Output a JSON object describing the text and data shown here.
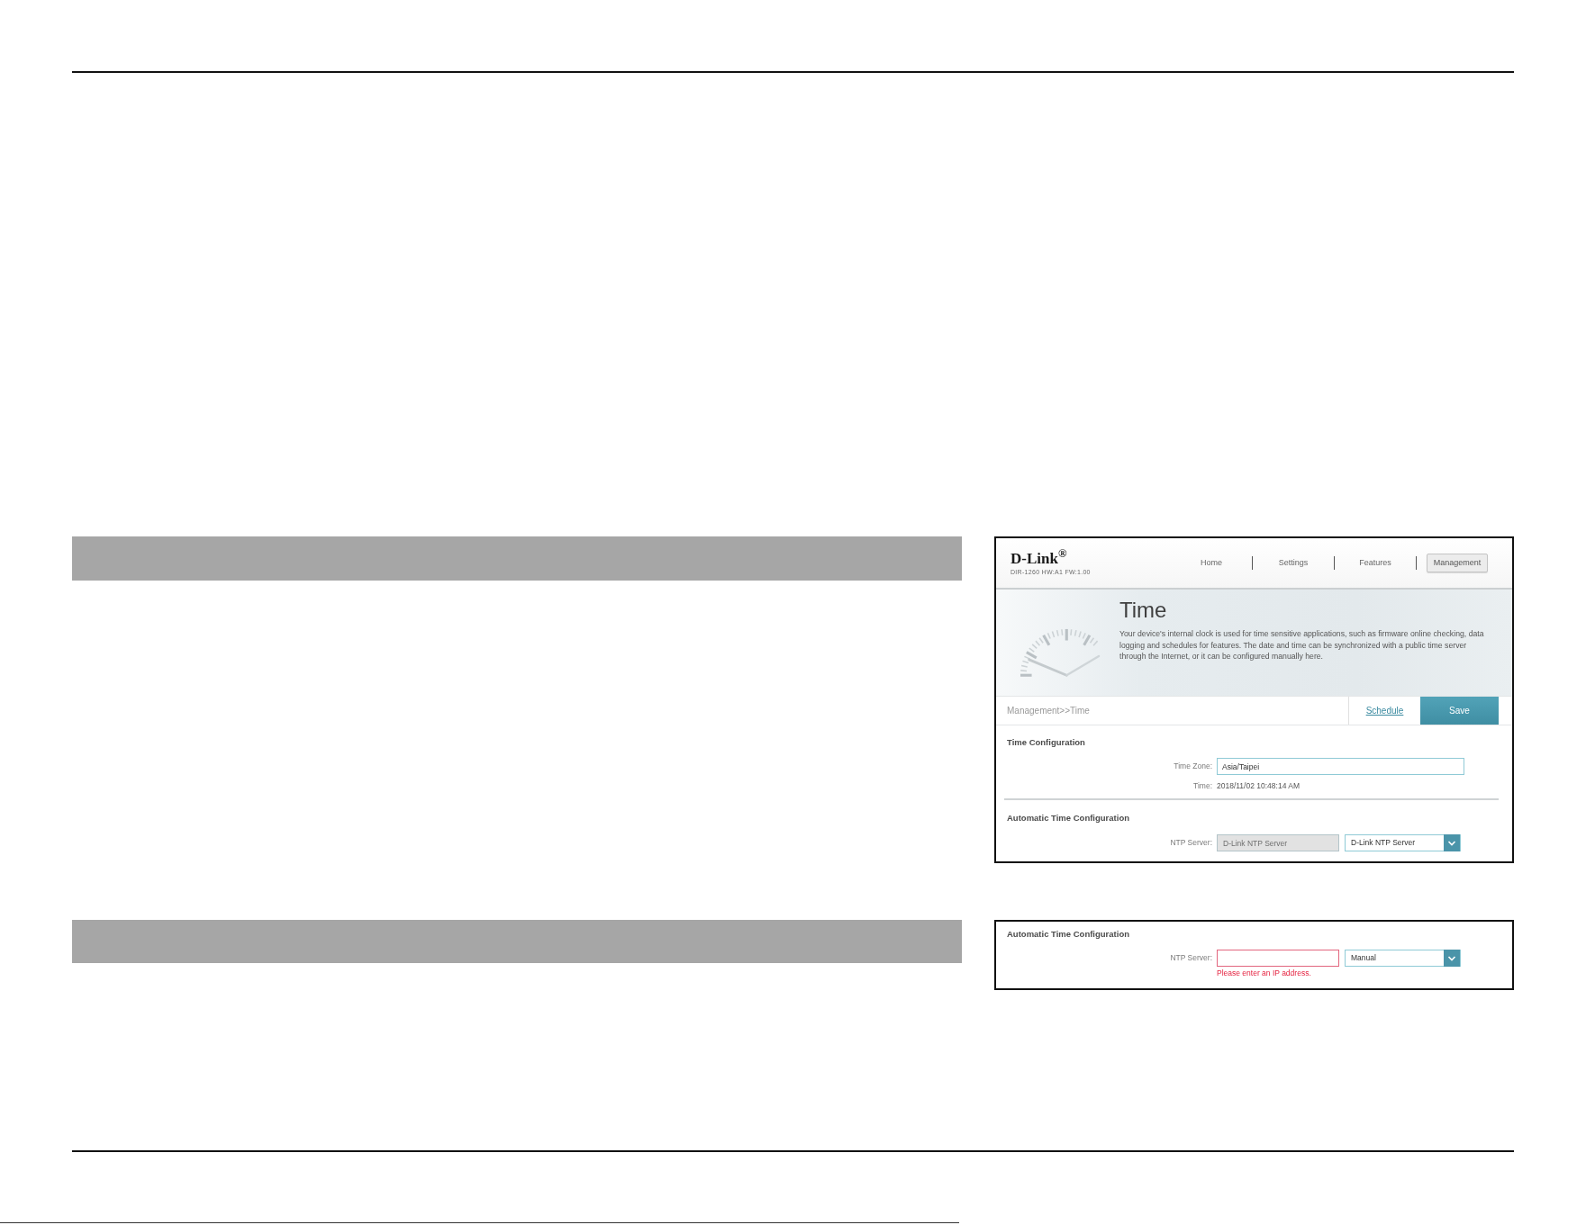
{
  "screenshot_1": {
    "header": {
      "logo": "D-Link$^{®}$",
      "model_info": "DIR-1260 HW:A1 FW:1.00",
      "nav": [
        {
          "label": "Home",
          "selected": false
        },
        {
          "label": "Settings",
          "selected": false
        },
        {
          "label": "Features",
          "selected": false
        },
        {
          "label": "Management",
          "selected": true
        }
      ]
    },
    "banner": {
      "title": "Time",
      "description": "Your device's internal clock is used for time sensitive applications, such as firmware online checking, data logging and schedules for features. The date and time can be synchronized with a public time server through the Internet, or it can be configured manually here."
    },
    "toolbar": {
      "breadcrumb": "Management>>Time",
      "buttons": [
        {
          "kind": "link",
          "label": "Schedule"
        },
        {
          "kind": "primary",
          "label": "Save"
        }
      ]
    },
    "sections": [
      {
        "title": "Time Configuration",
        "fields": [
          {
            "kind": "input",
            "label": "Time Zone:",
            "value": "Asia/Taipei"
          },
          {
            "kind": "text",
            "label": "Time:",
            "value": "2018/11/02 10:48:14 AM"
          }
        ]
      },
      {
        "title": "Automatic Time Configuration",
        "fields": [
          {
            "kind": "input_select",
            "label": "NTP Server:",
            "value": "D-Link NTP Server",
            "disabled": true,
            "select": "D-Link NTP Server"
          }
        ]
      }
    ]
  },
  "screenshot_2": {
    "sections": [
      {
        "title": "Automatic Time Configuration",
        "fields": [
          {
            "kind": "input_select",
            "label": "NTP Server:",
            "disabled": false,
            "error": "Please enter an IP address.",
            "select": "Manual"
          }
        ]
      }
    ]
  }
}
